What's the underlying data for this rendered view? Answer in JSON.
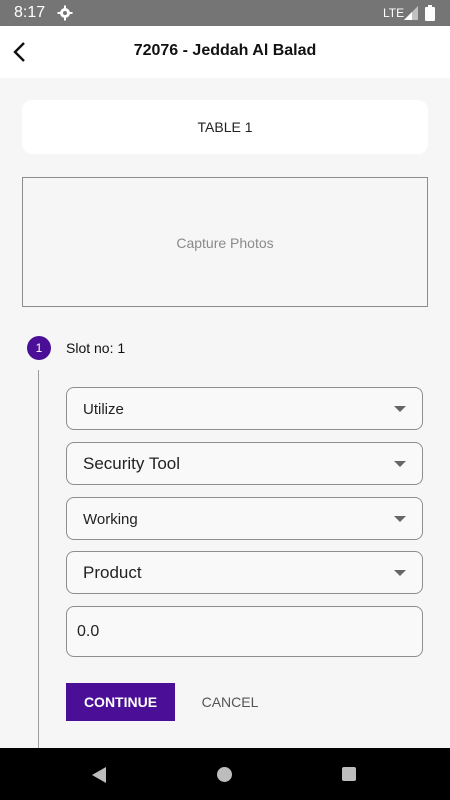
{
  "status_bar": {
    "time": "8:17",
    "network": "LTE",
    "icons": [
      "settings-gear-icon",
      "signal-icon",
      "battery-icon"
    ]
  },
  "app_bar": {
    "title": "72076 - Jeddah Al Balad",
    "back_icon": "back-arrow-icon"
  },
  "table_card": {
    "label": "TABLE 1"
  },
  "photo_box": {
    "label": "Capture Photos"
  },
  "step": {
    "number": "1",
    "label": "Slot no: 1"
  },
  "fields": {
    "utilization": "Utilize",
    "category": "Security Tool",
    "status": "Working",
    "type": "Product",
    "quantity": "0.0"
  },
  "actions": {
    "continue_label": "CONTINUE",
    "cancel_label": "CANCEL"
  },
  "colors": {
    "accent": "#4b0f97",
    "status_bar": "#757575",
    "background": "#f6f6f6"
  }
}
